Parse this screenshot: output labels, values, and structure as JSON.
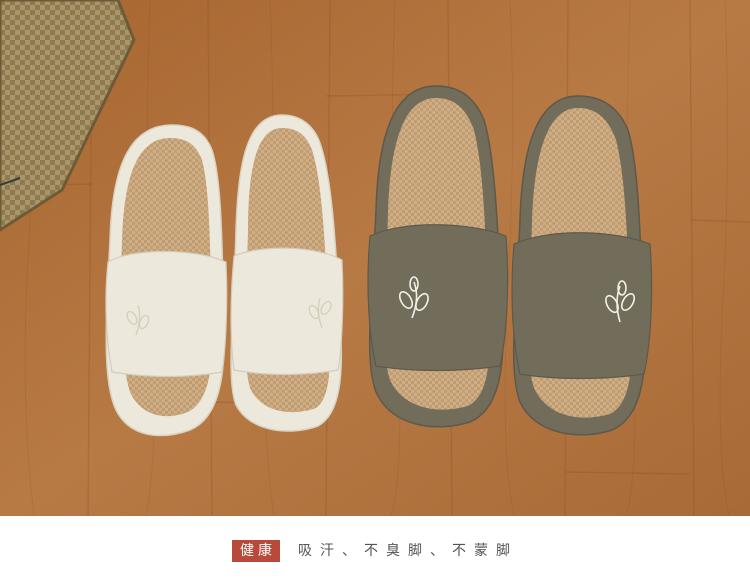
{
  "photo": {
    "subject_icons": [
      "slipper-icon",
      "leaf-icon",
      "basket-icon"
    ],
    "colors": {
      "floor": "#b06f3c",
      "floor_dark": "#8f5427",
      "cream_slipper": "#ece8db",
      "olive_slipper": "#726c5b",
      "jute_insole": "#cfae85",
      "basket": "#a99568"
    }
  },
  "caption": {
    "badge": "健康",
    "tagline": "吸汗、不臭脚、不蒙脚",
    "badge_color": "#b84a3b"
  }
}
